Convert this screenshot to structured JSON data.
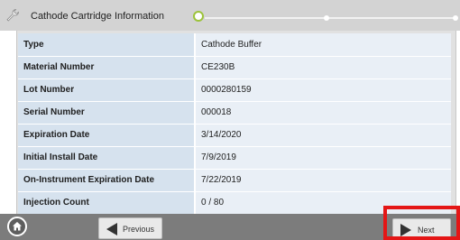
{
  "header": {
    "title": "Cathode Cartridge Information"
  },
  "progress": {
    "total_steps": 3,
    "current_step": 1,
    "active_color": "#9cc33a"
  },
  "info_rows": [
    {
      "label": "Type",
      "value": "Cathode Buffer"
    },
    {
      "label": "Material Number",
      "value": "CE230B"
    },
    {
      "label": "Lot Number",
      "value": "0000280159"
    },
    {
      "label": "Serial Number",
      "value": "000018"
    },
    {
      "label": "Expiration Date",
      "value": "3/14/2020"
    },
    {
      "label": "Initial Install Date",
      "value": "7/9/2019"
    },
    {
      "label": "On-Instrument Expiration Date",
      "value": "7/22/2019"
    },
    {
      "label": "Injection Count",
      "value": "0 / 80"
    }
  ],
  "footer": {
    "home_icon": "home-icon",
    "previous_label": "Previous",
    "next_label": "Next",
    "highlight_color": "#e41616"
  }
}
